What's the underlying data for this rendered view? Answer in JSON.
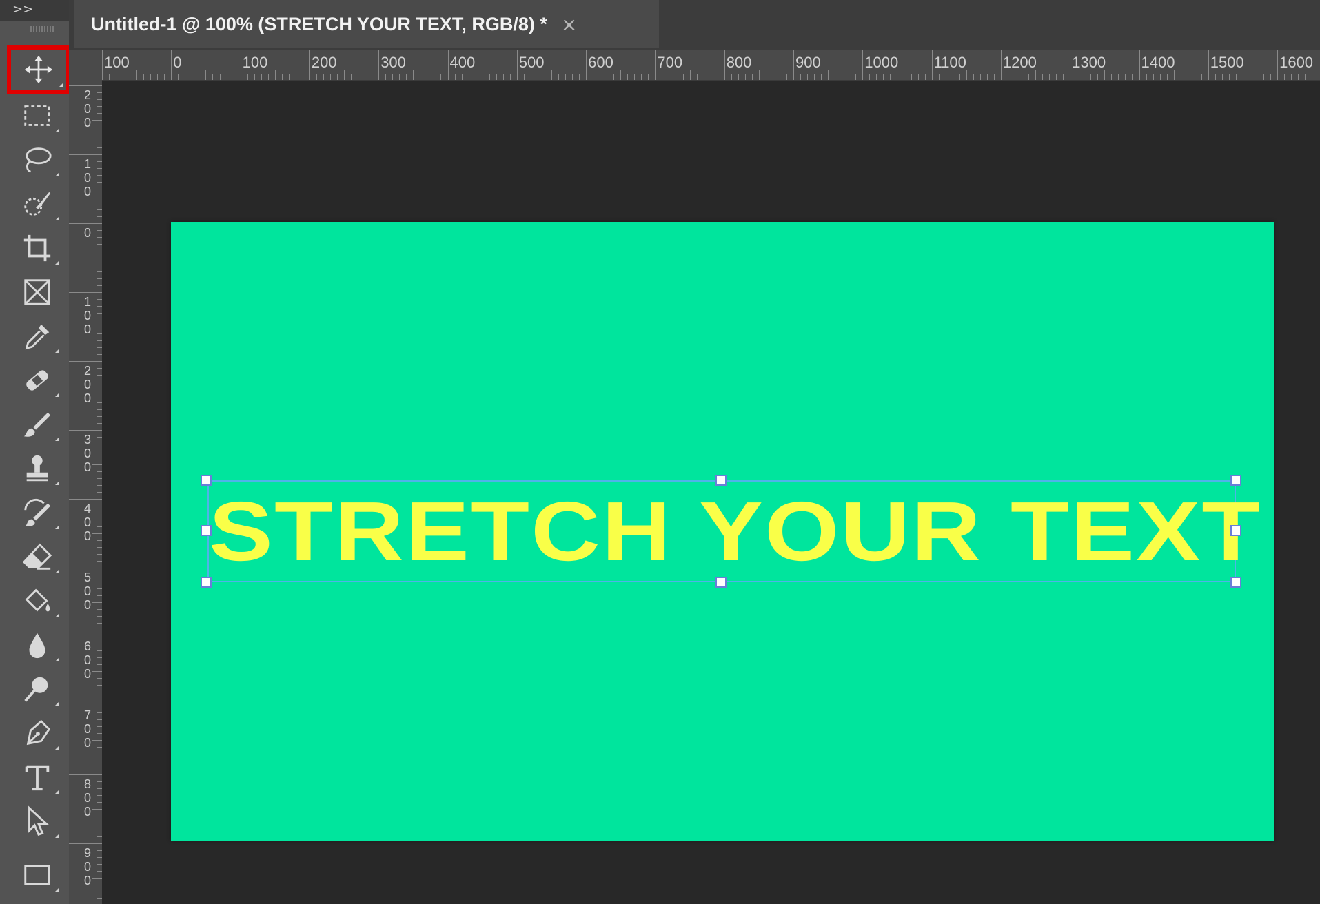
{
  "toolbar": {
    "collapse_label": ">>",
    "tools": [
      {
        "name": "move-tool",
        "icon": "move-icon",
        "selected": true
      },
      {
        "name": "marquee-tool",
        "icon": "rectangular-marquee-icon"
      },
      {
        "name": "lasso-tool",
        "icon": "lasso-icon"
      },
      {
        "name": "quick-selection-tool",
        "icon": "quick-selection-brush-icon"
      },
      {
        "name": "crop-tool",
        "icon": "crop-icon"
      },
      {
        "name": "frame-tool",
        "icon": "frame-icon"
      },
      {
        "name": "eyedropper-tool",
        "icon": "eyedropper-icon"
      },
      {
        "name": "healing-brush-tool",
        "icon": "bandage-icon"
      },
      {
        "name": "brush-tool",
        "icon": "brush-icon"
      },
      {
        "name": "clone-stamp-tool",
        "icon": "stamp-icon"
      },
      {
        "name": "history-brush-tool",
        "icon": "history-brush-icon"
      },
      {
        "name": "eraser-tool",
        "icon": "eraser-icon"
      },
      {
        "name": "paint-bucket-tool",
        "icon": "paint-bucket-icon"
      },
      {
        "name": "blur-tool",
        "icon": "water-drop-icon"
      },
      {
        "name": "dodge-tool",
        "icon": "dodge-icon"
      },
      {
        "name": "pen-tool",
        "icon": "pen-nib-icon"
      },
      {
        "name": "type-tool",
        "icon": "type-icon"
      },
      {
        "name": "path-selection-tool",
        "icon": "arrow-cursor-icon"
      },
      {
        "name": "rectangle-tool",
        "icon": "rectangle-icon"
      }
    ],
    "highlight_color": "#e00000"
  },
  "document_tab": {
    "title": "Untitled-1 @ 100% (STRETCH YOUR TEXT, RGB/8) *",
    "close_label": "×"
  },
  "ruler_top": {
    "labels": [
      "100",
      "0",
      "100",
      "200",
      "300",
      "400",
      "500",
      "600",
      "700",
      "800",
      "900",
      "1000",
      "1100",
      "1200",
      "1300",
      "1400",
      "1500",
      "1600"
    ]
  },
  "ruler_left": {
    "labels": [
      "200",
      "100",
      "0",
      "100",
      "200",
      "300",
      "400",
      "500",
      "600",
      "700",
      "800",
      "900"
    ]
  },
  "canvas": {
    "background_color": "#00e59d",
    "text_layer": {
      "text": "STRETCH YOUR TEXT",
      "color": "#f9ff48",
      "bounding_box_color": "#4fb3e8"
    }
  }
}
